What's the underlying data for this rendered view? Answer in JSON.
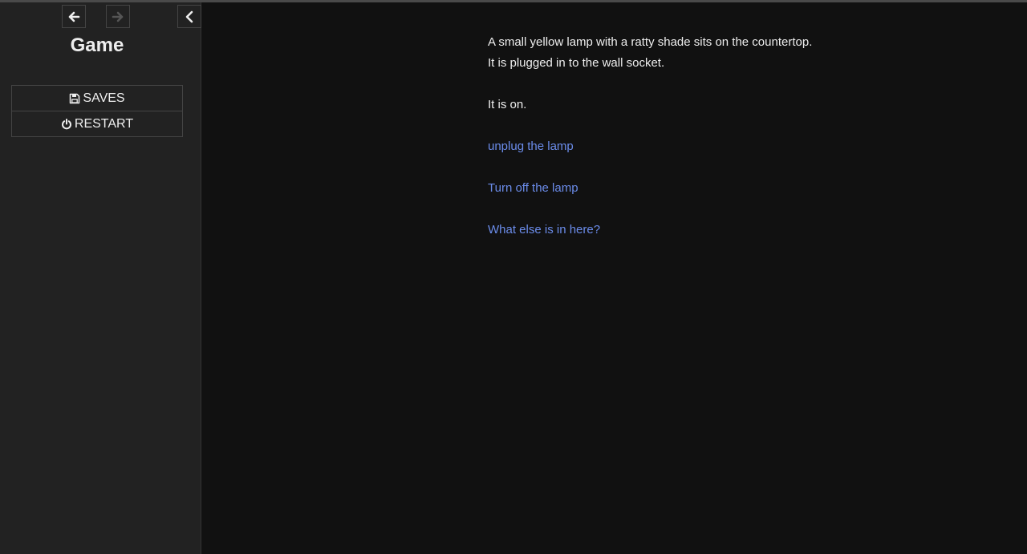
{
  "sidebar": {
    "story_title": "Game",
    "nav": {
      "back_icon": "arrow-left-icon",
      "forward_icon": "arrow-right-icon",
      "collapse_icon": "chevron-left-icon",
      "forward_enabled": false
    },
    "menu": {
      "saves_label": "SAVES",
      "saves_icon": "floppy-disk-icon",
      "restart_label": "RESTART",
      "restart_icon": "power-icon"
    }
  },
  "passage": {
    "line1": "A small yellow lamp with a ratty shade sits on the countertop.",
    "line2": "It is plugged in to the wall socket.",
    "status": "It is on.",
    "links": [
      "unplug the lamp",
      "Turn off the lamp",
      "What else is in here?"
    ]
  },
  "colors": {
    "background": "#111111",
    "sidebar": "#222222",
    "text": "#eeeeee",
    "link": "#6b8cea",
    "border": "#444444"
  }
}
